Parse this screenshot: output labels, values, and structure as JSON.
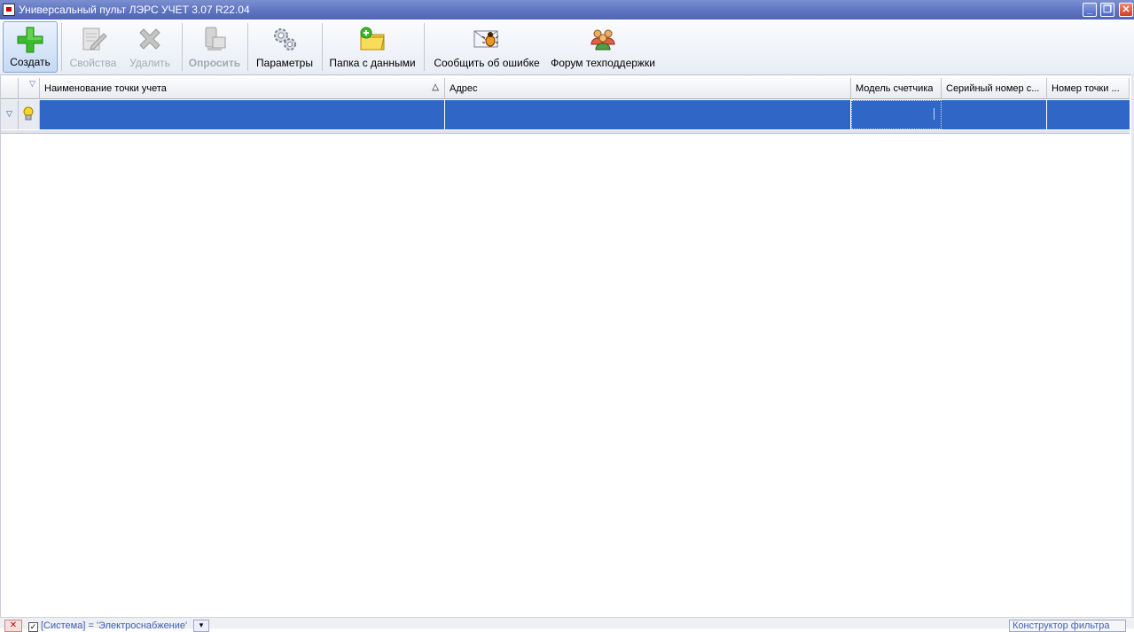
{
  "window": {
    "title": "Универсальный пульт ЛЭРС УЧЕТ 3.07 R22.04",
    "minimize_label": "_",
    "restore_label": "❐",
    "close_label": "✕"
  },
  "toolbar": {
    "create": "Создать",
    "properties": "Свойства",
    "delete": "Удалить",
    "poll": "Опросить",
    "parameters": "Параметры",
    "data_folder": "Папка с данными",
    "report_error": "Сообщить об ошибке",
    "forum": "Форум техподдержки"
  },
  "grid": {
    "columns": [
      "Наименование точки учета",
      "Адрес",
      "Модель счетчика",
      "Серийный номер с...",
      "Номер точки ..."
    ],
    "sort_indicator": "△",
    "filter_indicator": "▽"
  },
  "filterbar": {
    "close_label": "✕",
    "check_label": "✓",
    "filter_text": "[Система] = 'Электроснабжение'",
    "dropdown_label": "▾",
    "builder_label": "Конструктор фильтра"
  },
  "colors": {
    "titlebar": "#5d72c0",
    "selection": "#3067c6",
    "create_icon": "#3cbb2c"
  }
}
